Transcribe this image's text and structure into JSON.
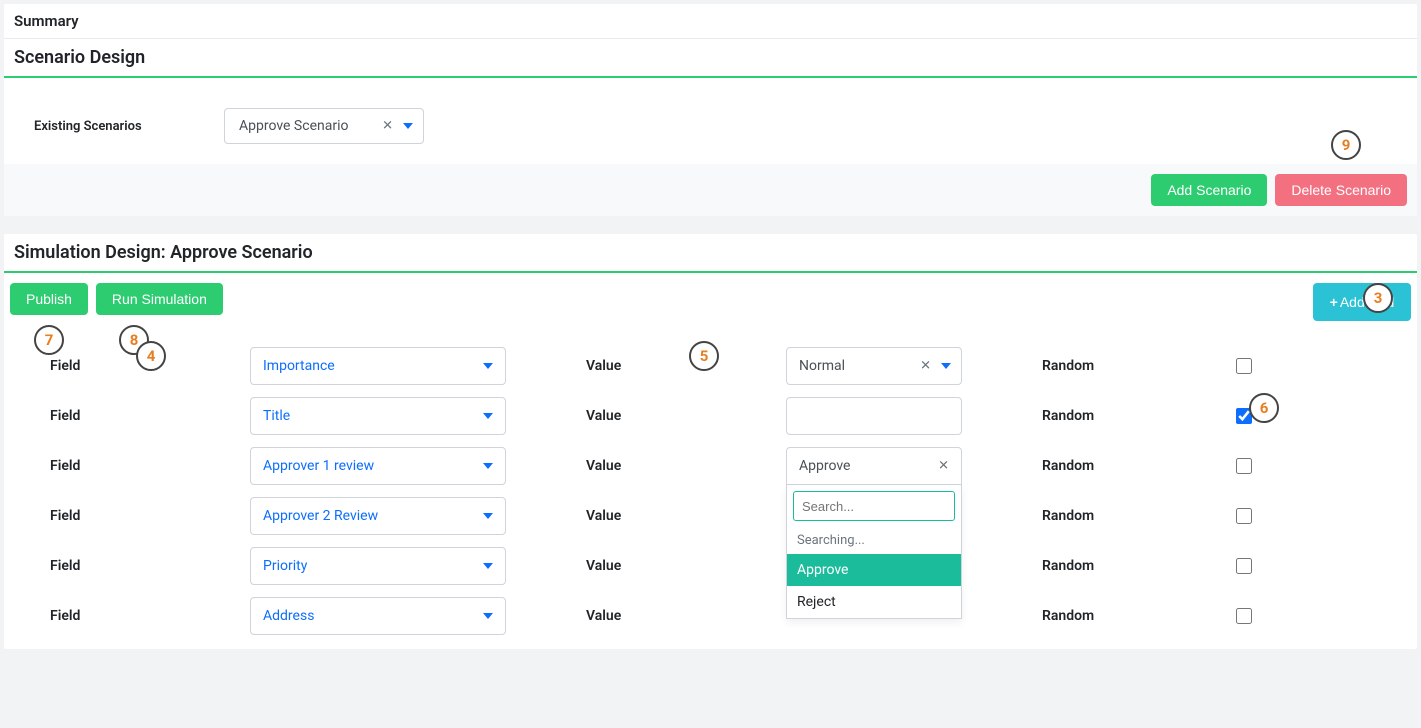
{
  "summary": {
    "title": "Summary"
  },
  "scenario": {
    "title": "Scenario Design",
    "existing_label": "Existing Scenarios",
    "selected": "Approve Scenario",
    "add_button": "Add Scenario",
    "delete_button": "Delete Scenario"
  },
  "sim": {
    "title": "Simulation Design: Approve Scenario",
    "publish": "Publish",
    "run": "Run Simulation",
    "add_field": "Add field",
    "field_label": "Field",
    "value_label": "Value",
    "random_label": "Random",
    "rows": [
      {
        "field": "Importance",
        "value": "Normal",
        "has_clear": true,
        "has_caret": true,
        "random": false,
        "value_type": "select"
      },
      {
        "field": "Title",
        "value": "",
        "has_clear": false,
        "has_caret": false,
        "random": true,
        "value_type": "text"
      },
      {
        "field": "Approver 1 review",
        "value": "Approve",
        "has_clear": true,
        "has_caret": false,
        "random": false,
        "value_type": "select_open"
      },
      {
        "field": "Approver 2 Review",
        "value": "",
        "has_clear": false,
        "has_caret": false,
        "random": false,
        "value_type": "none_dropdown_origin"
      },
      {
        "field": "Priority",
        "value": "",
        "has_clear": false,
        "has_caret": false,
        "random": false,
        "value_type": "none"
      },
      {
        "field": "Address",
        "value": "",
        "has_clear": false,
        "has_caret": false,
        "random": false,
        "value_type": "none"
      }
    ],
    "dropdown": {
      "search_placeholder": "Search...",
      "status": "Searching...",
      "options": [
        "Approve",
        "Reject"
      ],
      "selected_index": 0
    }
  },
  "annotations": {
    "a3": "3",
    "a4": "4",
    "a5": "5",
    "a6": "6",
    "a7": "7",
    "a8": "8",
    "a9": "9"
  }
}
